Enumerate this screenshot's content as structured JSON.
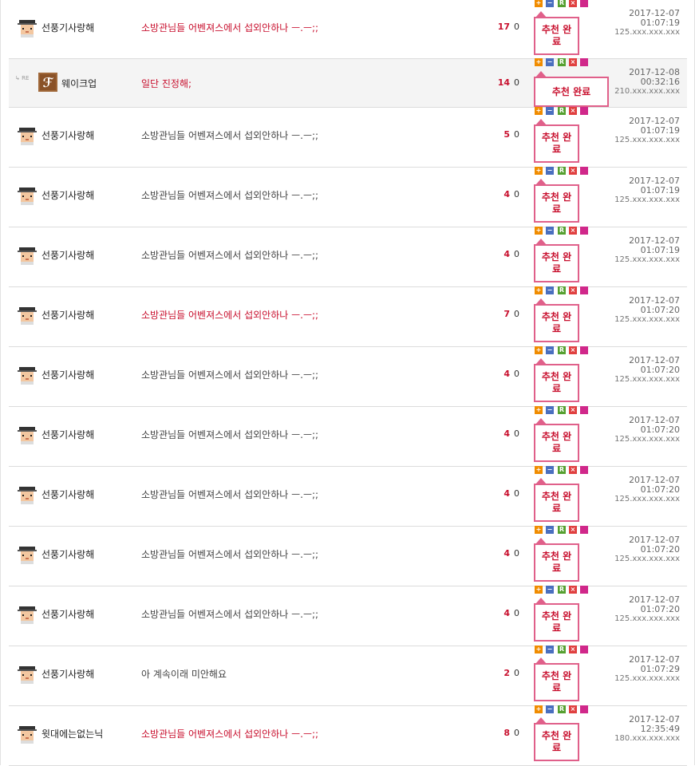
{
  "rows": [
    {
      "reply": false,
      "nick": "선풍기사랑해",
      "avatar": "helmet-avatar",
      "message": "소방관님들 어벤져스에서 섭외안하나 ㅡ.ㅡ;;",
      "hot": true,
      "recommend": "17",
      "oppose": "0",
      "rec_label": "추천 완료",
      "date": "2017-12-07",
      "time": "01:07:19",
      "ip": "125.xxx.xxx.xxx"
    },
    {
      "reply": true,
      "re_mark": "RE",
      "nick": "웨이크업",
      "avatar": "brown-avatar",
      "message": "일단 진정해;",
      "hot": true,
      "recommend": "14",
      "oppose": "0",
      "rec_label": "추천 완료",
      "date": "2017-12-08",
      "time": "00:32:16",
      "ip": "210.xxx.xxx.xxx"
    },
    {
      "reply": false,
      "nick": "선풍기사랑해",
      "avatar": "helmet-avatar",
      "message": "소방관님들 어벤져스에서 섭외안하나 ㅡ.ㅡ;;",
      "hot": false,
      "recommend": "5",
      "oppose": "0",
      "rec_label": "추천 완료",
      "date": "2017-12-07",
      "time": "01:07:19",
      "ip": "125.xxx.xxx.xxx"
    },
    {
      "reply": false,
      "nick": "선풍기사랑해",
      "avatar": "helmet-avatar",
      "message": "소방관님들 어벤져스에서 섭외안하나 ㅡ.ㅡ;;",
      "hot": false,
      "recommend": "4",
      "oppose": "0",
      "rec_label": "추천 완료",
      "date": "2017-12-07",
      "time": "01:07:19",
      "ip": "125.xxx.xxx.xxx"
    },
    {
      "reply": false,
      "nick": "선풍기사랑해",
      "avatar": "helmet-avatar",
      "message": "소방관님들 어벤져스에서 섭외안하나 ㅡ.ㅡ;;",
      "hot": false,
      "recommend": "4",
      "oppose": "0",
      "rec_label": "추천 완료",
      "date": "2017-12-07",
      "time": "01:07:19",
      "ip": "125.xxx.xxx.xxx"
    },
    {
      "reply": false,
      "nick": "선풍기사랑해",
      "avatar": "helmet-avatar",
      "message": "소방관님들 어벤져스에서 섭외안하나 ㅡ.ㅡ;;",
      "hot": true,
      "recommend": "7",
      "oppose": "0",
      "rec_label": "추천 완료",
      "date": "2017-12-07",
      "time": "01:07:20",
      "ip": "125.xxx.xxx.xxx"
    },
    {
      "reply": false,
      "nick": "선풍기사랑해",
      "avatar": "helmet-avatar",
      "message": "소방관님들 어벤져스에서 섭외안하나 ㅡ.ㅡ;;",
      "hot": false,
      "recommend": "4",
      "oppose": "0",
      "rec_label": "추천 완료",
      "date": "2017-12-07",
      "time": "01:07:20",
      "ip": "125.xxx.xxx.xxx"
    },
    {
      "reply": false,
      "nick": "선풍기사랑해",
      "avatar": "helmet-avatar",
      "message": "소방관님들 어벤져스에서 섭외안하나 ㅡ.ㅡ;;",
      "hot": false,
      "recommend": "4",
      "oppose": "0",
      "rec_label": "추천 완료",
      "date": "2017-12-07",
      "time": "01:07:20",
      "ip": "125.xxx.xxx.xxx"
    },
    {
      "reply": false,
      "nick": "선풍기사랑해",
      "avatar": "helmet-avatar",
      "message": "소방관님들 어벤져스에서 섭외안하나 ㅡ.ㅡ;;",
      "hot": false,
      "recommend": "4",
      "oppose": "0",
      "rec_label": "추천 완료",
      "date": "2017-12-07",
      "time": "01:07:20",
      "ip": "125.xxx.xxx.xxx"
    },
    {
      "reply": false,
      "nick": "선풍기사랑해",
      "avatar": "helmet-avatar",
      "message": "소방관님들 어벤져스에서 섭외안하나 ㅡ.ㅡ;;",
      "hot": false,
      "recommend": "4",
      "oppose": "0",
      "rec_label": "추천 완료",
      "date": "2017-12-07",
      "time": "01:07:20",
      "ip": "125.xxx.xxx.xxx"
    },
    {
      "reply": false,
      "nick": "선풍기사랑해",
      "avatar": "helmet-avatar",
      "message": "소방관님들 어벤져스에서 섭외안하나 ㅡ.ㅡ;;",
      "hot": false,
      "recommend": "4",
      "oppose": "0",
      "rec_label": "추천 완료",
      "date": "2017-12-07",
      "time": "01:07:20",
      "ip": "125.xxx.xxx.xxx"
    },
    {
      "reply": false,
      "nick": "선풍기사랑해",
      "avatar": "helmet-avatar",
      "message": "아 계속이래 미안해요",
      "hot": false,
      "recommend": "2",
      "oppose": "0",
      "rec_label": "추천 완료",
      "date": "2017-12-07",
      "time": "01:07:29",
      "ip": "125.xxx.xxx.xxx"
    },
    {
      "reply": false,
      "nick": "윗대에는없는닉",
      "avatar": "helmet-avatar",
      "message": "소방관님들 어벤져스에서 섭외안하나 ㅡ.ㅡ;;",
      "hot": true,
      "recommend": "8",
      "oppose": "0",
      "rec_label": "추천 완료",
      "date": "2017-12-07",
      "time": "12:35:49",
      "ip": "180.xxx.xxx.xxx"
    }
  ],
  "action_icons": [
    {
      "icon": "plus-icon",
      "glyph": "+",
      "color": "#f08c00"
    },
    {
      "icon": "minus-icon",
      "glyph": "−",
      "color": "#4a6fbf"
    },
    {
      "icon": "report-icon",
      "glyph": "R",
      "color": "#55a030"
    },
    {
      "icon": "delete-icon",
      "glyph": "×",
      "color": "#e04040"
    },
    {
      "icon": "user-block-icon",
      "glyph": "",
      "color": "#d0288a"
    }
  ],
  "colors": {
    "hot_text": "#c8102e",
    "rec_border": "#e0608a",
    "reply_bg": "#f4f4f4"
  }
}
